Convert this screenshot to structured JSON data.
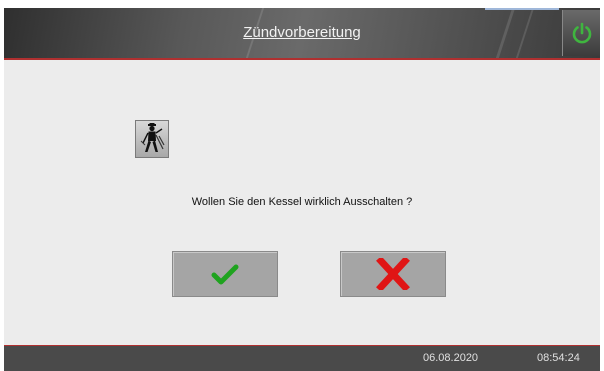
{
  "header": {
    "title": "Zündvorbereitung",
    "power_icon": "power-icon",
    "power_color": "#3fb53f"
  },
  "content": {
    "sweep_icon": "chimney-sweep-icon",
    "question": "Wollen Sie den Kessel wirklich Ausschalten ?",
    "confirm_icon": "checkmark-icon",
    "confirm_color": "#1fa31f",
    "cancel_icon": "cross-icon",
    "cancel_color": "#e01515"
  },
  "footer": {
    "date": "06.08.2020",
    "time": "08:54:24"
  }
}
